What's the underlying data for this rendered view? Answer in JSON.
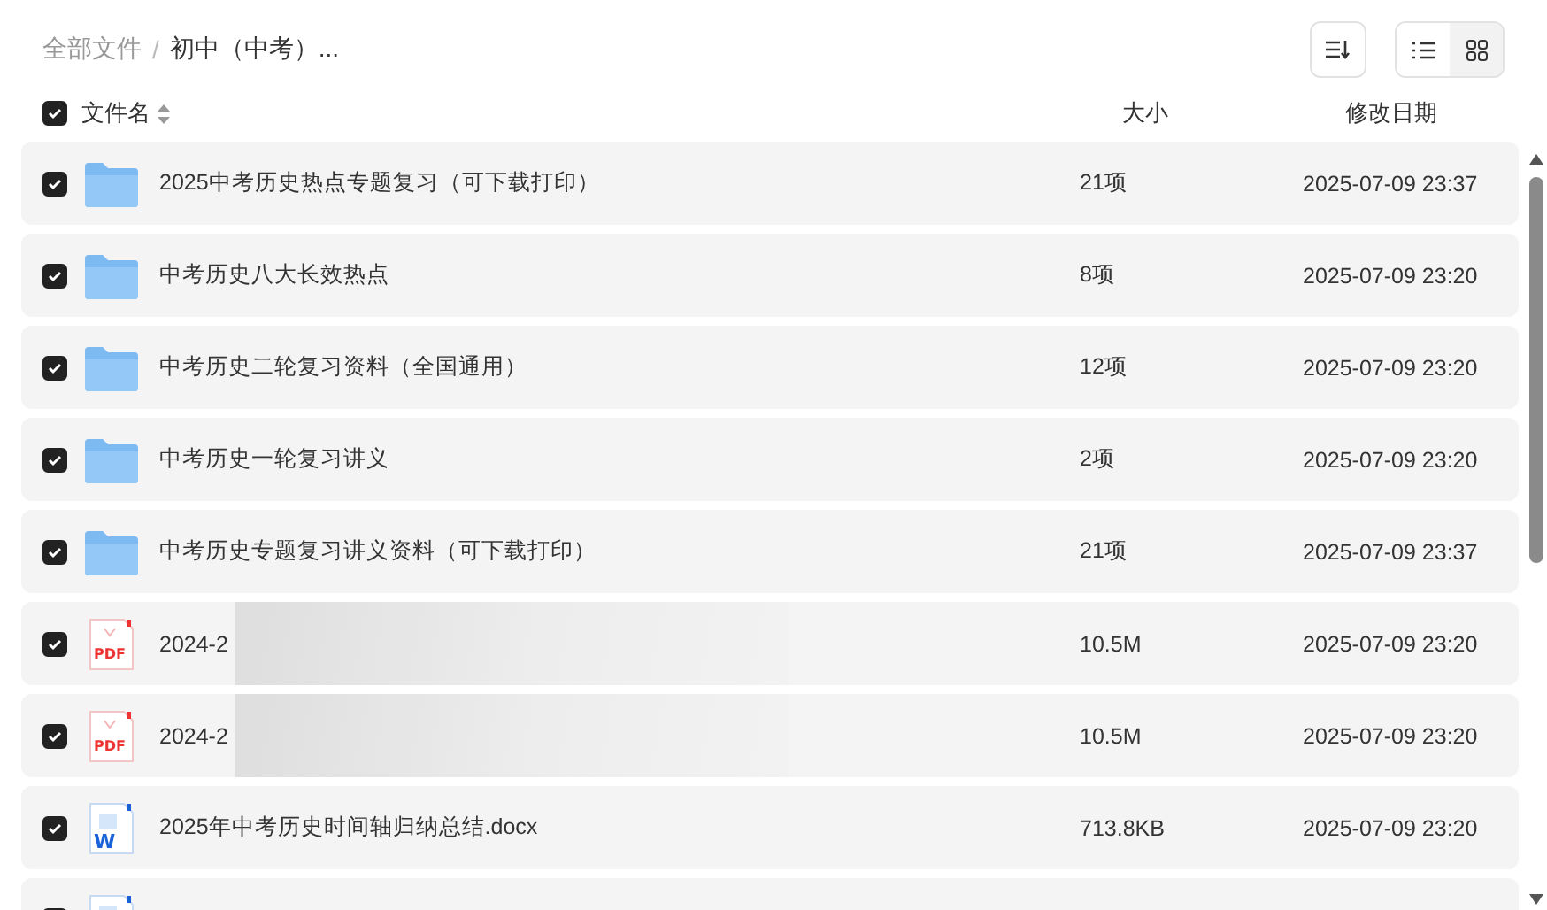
{
  "breadcrumb": {
    "separator": "/",
    "items": [
      {
        "label": "全部文件",
        "current": false
      },
      {
        "label": "初中（中考）...",
        "current": true
      }
    ]
  },
  "view_toggle": [
    {
      "kind": "list",
      "selected": true
    },
    {
      "kind": "grid",
      "selected": false
    }
  ],
  "columns": {
    "select_all": {
      "checked": true
    },
    "name": "文件名",
    "size": "大小",
    "date": "修改日期"
  },
  "rows": [
    {
      "kind": "folder",
      "checked": true,
      "name": "2025中考历史热点专题复习（可下载打印）",
      "size": "21项",
      "date": "2025-07-09 23:37"
    },
    {
      "kind": "folder",
      "checked": true,
      "name": "中考历史八大长效热点",
      "size": "8项",
      "date": "2025-07-09 23:20"
    },
    {
      "kind": "folder",
      "checked": true,
      "name": "中考历史二轮复习资料（全国通用）",
      "size": "12项",
      "date": "2025-07-09 23:20"
    },
    {
      "kind": "folder",
      "checked": true,
      "name": "中考历史一轮复习讲义",
      "size": "2项",
      "date": "2025-07-09 23:20"
    },
    {
      "kind": "folder",
      "checked": true,
      "name": "中考历史专题复习讲义资料（可下载打印）",
      "size": "21项",
      "date": "2025-07-09 23:37"
    },
    {
      "kind": "pdf",
      "icon_label": "PDF",
      "checked": true,
      "name": "2024-2",
      "redacted": true,
      "size": "10.5M",
      "date": "2025-07-09 23:20"
    },
    {
      "kind": "pdf",
      "icon_label": "PDF",
      "checked": true,
      "name": "2024-2",
      "redacted": true,
      "size": "10.5M",
      "date": "2025-07-09 23:20"
    },
    {
      "kind": "word",
      "icon_label": "W",
      "checked": true,
      "name": "2025年中考历史时间轴归纳总结.docx",
      "size": "713.8KB",
      "date": "2025-07-09 23:20"
    },
    {
      "kind": "word",
      "checked": true
    }
  ]
}
